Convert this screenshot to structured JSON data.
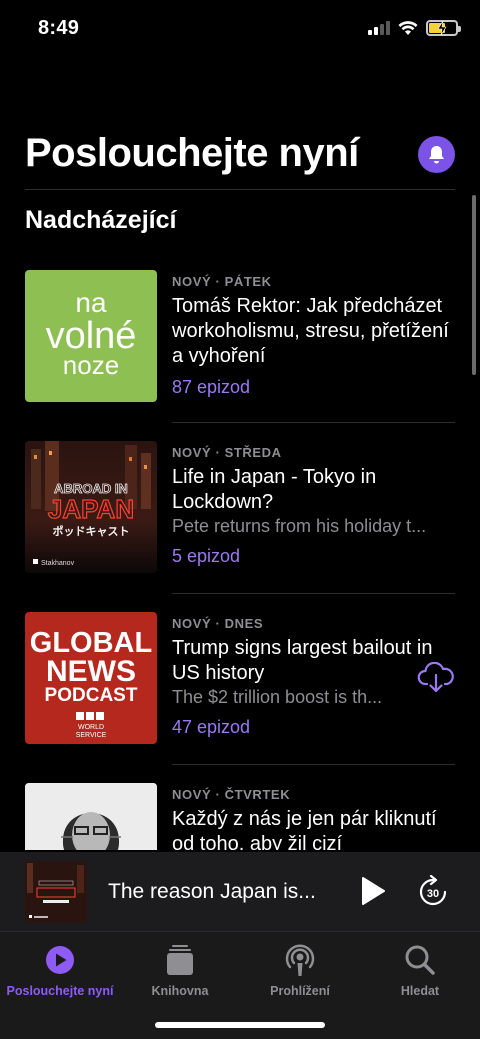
{
  "status": {
    "time": "8:49"
  },
  "header": {
    "title": "Poslouchejte nyní"
  },
  "section": {
    "title": "Nadcházející"
  },
  "items": [
    {
      "meta": "NOVÝ · PÁTEK",
      "title": "Tomáš Rektor: Jak předcházet workoholismu, stresu, přetížení a vyhoření",
      "description": "",
      "count": "87 epizod",
      "artwork": {
        "line1": "na",
        "line2": "volné",
        "line3": "noze",
        "bg": "#8dbf52"
      }
    },
    {
      "meta": "NOVÝ · STŘEDA",
      "title": "Life in Japan - Tokyo in Lockdown?",
      "description": "Pete returns from his holiday t...",
      "count": "5 epizod",
      "artwork": {
        "line1": "ABROAD IN",
        "line2": "JAPAN",
        "line3": "ポッドキャスト",
        "brand": "Stakhanov"
      }
    },
    {
      "meta": "NOVÝ · DNES",
      "title": "Trump signs largest bailout in US history",
      "description": "The $2 trillion boost is th...",
      "count": "47 epizod",
      "artwork": {
        "line1": "GLOBAL",
        "line2": "NEWS",
        "line3": "PODCAST",
        "logo": "BBC",
        "sub1": "WORLD",
        "sub2": "SERVICE",
        "bg": "#b5281d"
      }
    },
    {
      "meta": "NOVÝ · ČTVRTEK",
      "title": "Každý z nás je jen pár kliknutí od toho, aby žil cizí",
      "description": "",
      "count": ""
    }
  ],
  "player": {
    "title": "The reason Japan is..."
  },
  "tabs": [
    {
      "label": "Poslouchejte nyní",
      "icon": "play-circle-icon",
      "active": true
    },
    {
      "label": "Knihovna",
      "icon": "library-icon",
      "active": false
    },
    {
      "label": "Prohlížení",
      "icon": "podcast-icon",
      "active": false
    },
    {
      "label": "Hledat",
      "icon": "search-icon",
      "active": false
    }
  ],
  "colors": {
    "accent": "#8e5cf5",
    "bell_bg": "#7b53e6",
    "count_text": "#9b79f0",
    "background": "#000000"
  }
}
